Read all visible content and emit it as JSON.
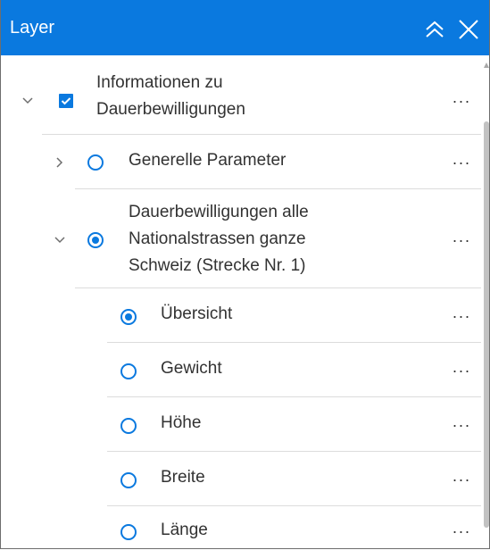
{
  "header": {
    "title": "Layer"
  },
  "layers": [
    {
      "label": "Informationen zu Dauerbewilligungen",
      "type": "checkbox",
      "checked": true,
      "expanded": true
    },
    {
      "label": "Generelle Parameter",
      "type": "radio",
      "checked": false,
      "expanded": false
    },
    {
      "label": "Dauerbewilligungen alle Nationalstrassen ganze Schweiz (Strecke Nr. 1)",
      "type": "radio",
      "checked": true,
      "expanded": true
    },
    {
      "label": "Übersicht",
      "type": "radio",
      "checked": true
    },
    {
      "label": "Gewicht",
      "type": "radio",
      "checked": false
    },
    {
      "label": "Höhe",
      "type": "radio",
      "checked": false
    },
    {
      "label": "Breite",
      "type": "radio",
      "checked": false
    },
    {
      "label": "Länge",
      "type": "radio",
      "checked": false
    }
  ],
  "more_label": "···",
  "colors": {
    "accent": "#0a79df",
    "text": "#323232",
    "divider": "#dcdcdc"
  }
}
